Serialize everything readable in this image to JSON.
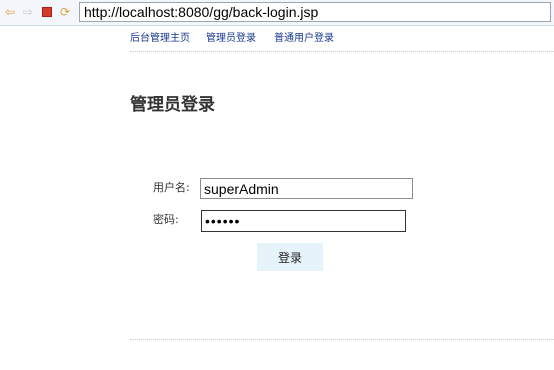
{
  "browser": {
    "url": "http://localhost:8080/gg/back-login.jsp",
    "icons": [
      "back-arrow-icon",
      "forward-arrow-icon",
      "stop-icon",
      "refresh-icon"
    ]
  },
  "nav": {
    "items": [
      {
        "label": "后台管理主页"
      },
      {
        "label": "管理员登录"
      },
      {
        "label": "普通用户登录"
      }
    ]
  },
  "page": {
    "title": "管理员登录"
  },
  "form": {
    "username_label": "用户名:",
    "username_value": "superAdmin",
    "password_label": "密码:",
    "password_value": "••••••",
    "submit_label": "登录"
  },
  "colors": {
    "link": "#1a3a8a",
    "button_bg": "#e6f3fb",
    "stop_red": "#d23a2e"
  }
}
